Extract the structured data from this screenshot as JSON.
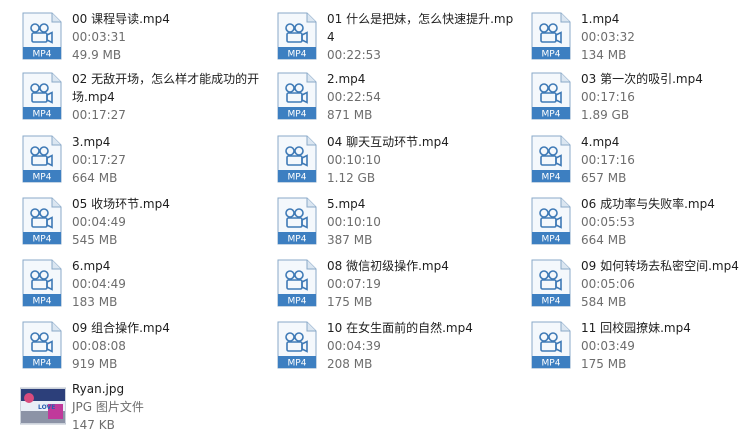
{
  "icon_label": "MP4",
  "files": [
    {
      "name": "00 课程导读.mp4",
      "line2": "00:03:31",
      "line3": "49.9 MB"
    },
    {
      "name": "01 什么是把妹，怎么快速提升.mp4",
      "line2": "00:22:53",
      "line3": ""
    },
    {
      "name": "1.mp4",
      "line2": "00:03:32",
      "line3": "134 MB"
    },
    {
      "name": "02 无敌开场，怎么样才能成功的开场.mp4",
      "line2": "00:17:27",
      "line3": ""
    },
    {
      "name": "2.mp4",
      "line2": "00:22:54",
      "line3": "871 MB"
    },
    {
      "name": "03 第一次的吸引.mp4",
      "line2": "00:17:16",
      "line3": "1.89 GB"
    },
    {
      "name": "3.mp4",
      "line2": "00:17:27",
      "line3": "664 MB"
    },
    {
      "name": "04 聊天互动环节.mp4",
      "line2": "00:10:10",
      "line3": "1.12 GB"
    },
    {
      "name": "4.mp4",
      "line2": "00:17:16",
      "line3": "657 MB"
    },
    {
      "name": "05 收场环节.mp4",
      "line2": "00:04:49",
      "line3": "545 MB"
    },
    {
      "name": "5.mp4",
      "line2": "00:10:10",
      "line3": "387 MB"
    },
    {
      "name": "06 成功率与失败率.mp4",
      "line2": "00:05:53",
      "line3": "664 MB"
    },
    {
      "name": "6.mp4",
      "line2": "00:04:49",
      "line3": "183 MB"
    },
    {
      "name": "08 微信初级操作.mp4",
      "line2": "00:07:19",
      "line3": "175 MB"
    },
    {
      "name": "09 如何转场去私密空间.mp4",
      "line2": "00:05:06",
      "line3": "584 MB"
    },
    {
      "name": "09 组合操作.mp4",
      "line2": "00:08:08",
      "line3": "919 MB"
    },
    {
      "name": "10 在女生面前的自然.mp4",
      "line2": "00:04:39",
      "line3": "208 MB"
    },
    {
      "name": "11 回校园撩妹.mp4",
      "line2": "00:03:49",
      "line3": "175 MB"
    }
  ],
  "image_file": {
    "name": "Ryan.jpg",
    "type": "JPG 图片文件",
    "size": "147 KB",
    "thumb_text": "LOVE"
  }
}
